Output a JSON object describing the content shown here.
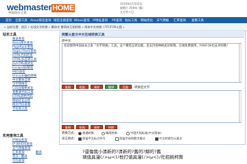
{
  "header": {
    "logo_main": "webmaster",
    "logo_home": "HOME",
    "logo_sub": "中国站长之家",
    "date_line1": "2016年07月02日",
    "date_line2": "星期六 丙申年 (猴)",
    "date_line3": "五月廿八日"
  },
  "nav": {
    "items": [
      "首页",
      "全部工具",
      "Alexa排名查询",
      "域名注册查询",
      "Whois查询",
      "IP地址查询",
      "PR查询",
      "站长工具",
      "网站优化",
      "天气预报",
      "汇率查询",
      "查看工具"
    ]
  },
  "breadcrumb": {
    "text": "» 当前位置：首页 » 在线文字转换 » 繁体字 繁简体互相转换 » 简体中文转换 / FFF/FOX火狐 »"
  },
  "sidebar": {
    "section1_title": "站长工具",
    "section1_items": [
      "收录查询",
      "Alexa排名查询",
      "PageRank查询",
      "Sogou Rank查询",
      "HTML代码检查",
      "HTML/JS互转工具",
      "JS/HTML格式化",
      "Escape加/解密",
      "MD5加密",
      "Unicode编码转换",
      "中文繁体互转",
      "汉字转拼音",
      "CSS压缩格式化",
      "查看源代码工具",
      "HTML颜色代码",
      "网站优化分析",
      "网页代码查看",
      "字符串工具"
    ],
    "section2_title": "实用查询工具",
    "section2_items": [
      "IP地址查询",
      "IP WHOIS查询",
      "天气预报查询",
      "汇率查询",
      "英汉 · 翻译",
      "学历查询",
      "身份证号码查询",
      "机票价格查询",
      "人民币大写"
    ],
    "section2_extra": "翻译"
  },
  "panel": {
    "title": "简繁火星文中文在线转换工具",
    "input_label": "原中文:",
    "input_value": "欢迎使用中国站长之家「文字转换」工具，这个繁简互转功能，还支持各种格式对照哦，在线免费使用，FIREFOX也支持的哦！",
    "buttons": [
      "复制",
      "粘贴",
      "清除",
      "翻译",
      "回复"
    ],
    "output_label": "转换后文字:",
    "buttons2": [
      "复制",
      "粘贴",
      "清除",
      "转换"
    ],
    "convert_label": "转换方式:",
    "convert_options": [
      "普通转换",
      "精简转换",
      "中国大陆标准(中文简体)"
    ],
    "convert_selected": 0,
    "format_label": "语言格式:",
    "format_options": [
      "保留中文标点符号",
      "保留字母和数字格式",
      "中文转换为火星文"
    ],
    "format_checked": [
      true,
      false,
      true
    ]
  },
  "result": {
    "line1": "?還傷我小清新的?清新的?舊的?鄰的?舊",
    "line2": "璃值具漫(ﾉ>ω<)ﾉ枕打値具漫(ﾉ>ω<)ﾉ社招挑柯賞"
  }
}
